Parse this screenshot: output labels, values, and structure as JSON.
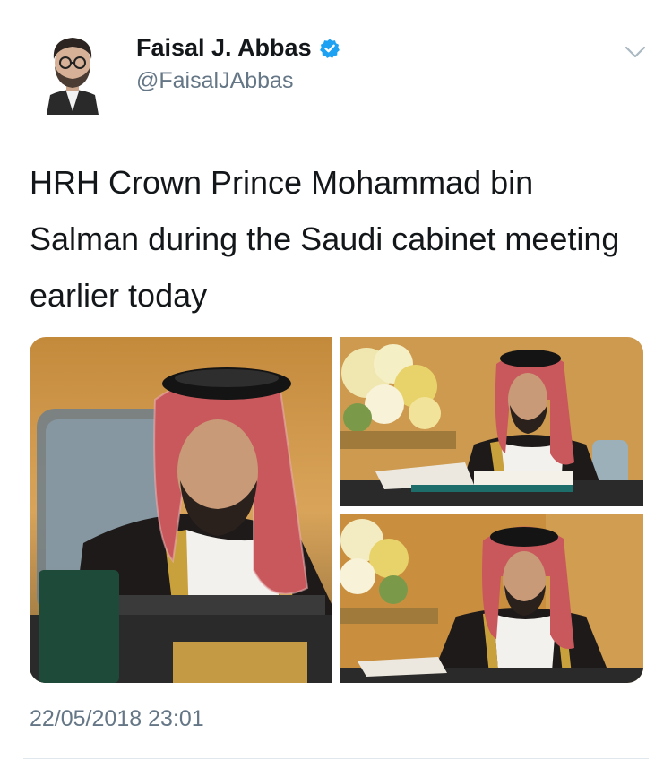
{
  "author": {
    "display_name": "Faisal J. Abbas",
    "handle": "@FaisalJAbbas",
    "avatar_icon": "profile-photo",
    "verified_icon": "verified-badge-icon",
    "verified_color": "#1da1f2"
  },
  "menu": {
    "caret_icon": "chevron-down-icon"
  },
  "tweet": {
    "text": "HRH Crown Prince Mohammad bin Salman during the Saudi cabinet meeting earlier today",
    "timestamp": "22/05/2018 23:01"
  },
  "media": {
    "count": 3
  },
  "colors": {
    "text_primary": "#14171a",
    "text_secondary": "#657786",
    "divider": "#e1e8ed"
  }
}
